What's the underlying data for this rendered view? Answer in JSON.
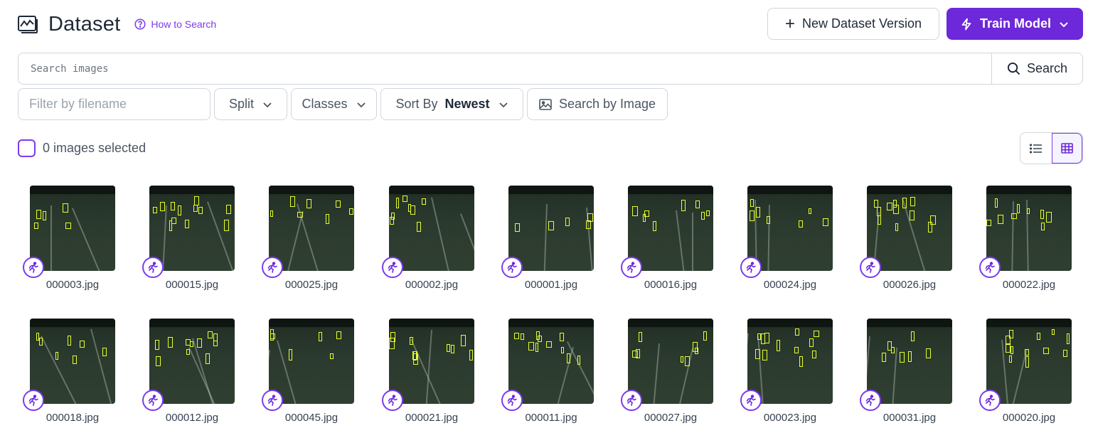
{
  "header": {
    "title": "Dataset",
    "how_to_search": "How to Search",
    "new_version_label": "New Dataset Version",
    "train_label": "Train Model",
    "accent_color": "#6d28d9"
  },
  "search": {
    "placeholder": "Search images",
    "button_label": "Search"
  },
  "filters": {
    "filename_placeholder": "Filter by filename",
    "split_label": "Split",
    "classes_label": "Classes",
    "sort_label": "Sort By",
    "sort_value": "Newest",
    "search_by_image_label": "Search by Image"
  },
  "selection": {
    "text": "0 images selected"
  },
  "images": [
    {
      "filename": "000003.jpg"
    },
    {
      "filename": "000015.jpg"
    },
    {
      "filename": "000025.jpg"
    },
    {
      "filename": "000002.jpg"
    },
    {
      "filename": "000001.jpg"
    },
    {
      "filename": "000016.jpg"
    },
    {
      "filename": "000024.jpg"
    },
    {
      "filename": "000026.jpg"
    },
    {
      "filename": "000022.jpg"
    },
    {
      "filename": "000018.jpg"
    },
    {
      "filename": "000012.jpg"
    },
    {
      "filename": "000045.jpg"
    },
    {
      "filename": "000021.jpg"
    },
    {
      "filename": "000011.jpg"
    },
    {
      "filename": "000027.jpg"
    },
    {
      "filename": "000023.jpg"
    },
    {
      "filename": "000031.jpg"
    },
    {
      "filename": "000020.jpg"
    }
  ]
}
